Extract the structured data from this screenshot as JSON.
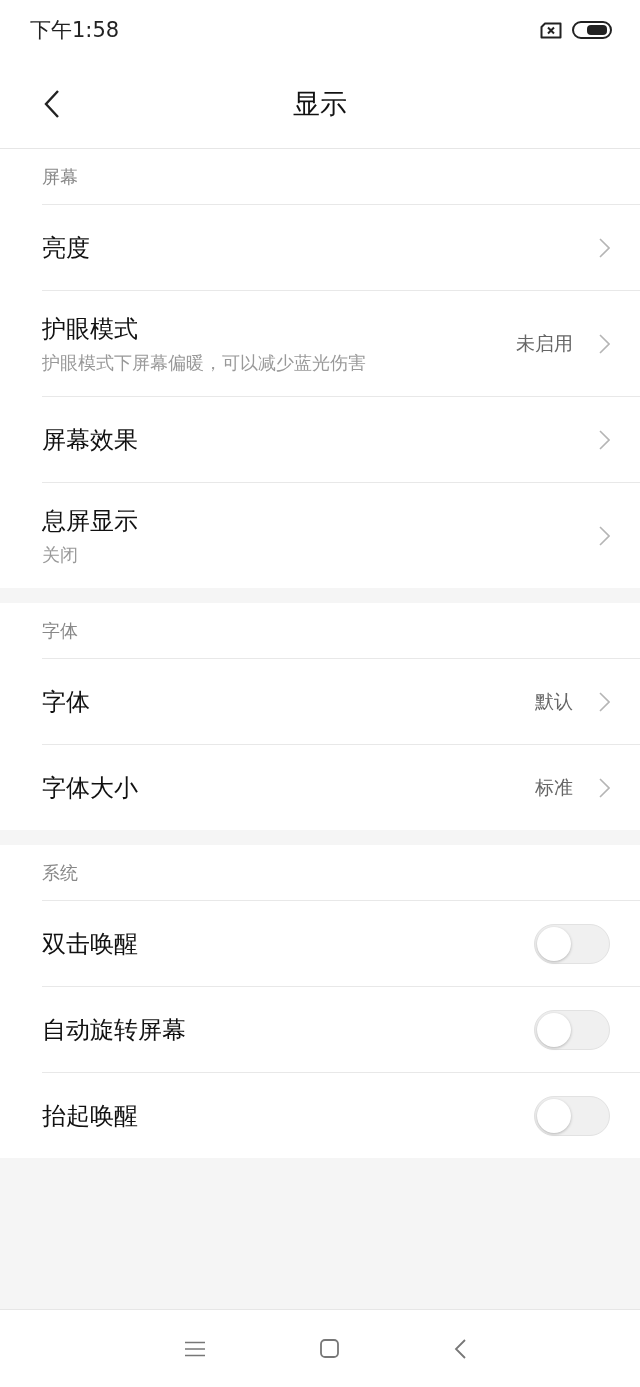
{
  "status_bar": {
    "time": "下午1:58"
  },
  "header": {
    "title": "显示"
  },
  "sections": [
    {
      "title": "屏幕",
      "items": [
        {
          "kind": "link",
          "label": "亮度"
        },
        {
          "kind": "link",
          "label": "护眼模式",
          "subtitle": "护眼模式下屏幕偏暖，可以减少蓝光伤害",
          "value": "未启用"
        },
        {
          "kind": "link",
          "label": "屏幕效果"
        },
        {
          "kind": "link",
          "label": "息屏显示",
          "subtitle": "关闭"
        }
      ]
    },
    {
      "title": "字体",
      "items": [
        {
          "kind": "link",
          "label": "字体",
          "value": "默认"
        },
        {
          "kind": "link",
          "label": "字体大小",
          "value": "标准"
        }
      ]
    },
    {
      "title": "系统",
      "items": [
        {
          "kind": "toggle",
          "label": "双击唤醒",
          "on": false
        },
        {
          "kind": "toggle",
          "label": "自动旋转屏幕",
          "on": false
        },
        {
          "kind": "toggle",
          "label": "抬起唤醒",
          "on": false
        }
      ]
    }
  ]
}
